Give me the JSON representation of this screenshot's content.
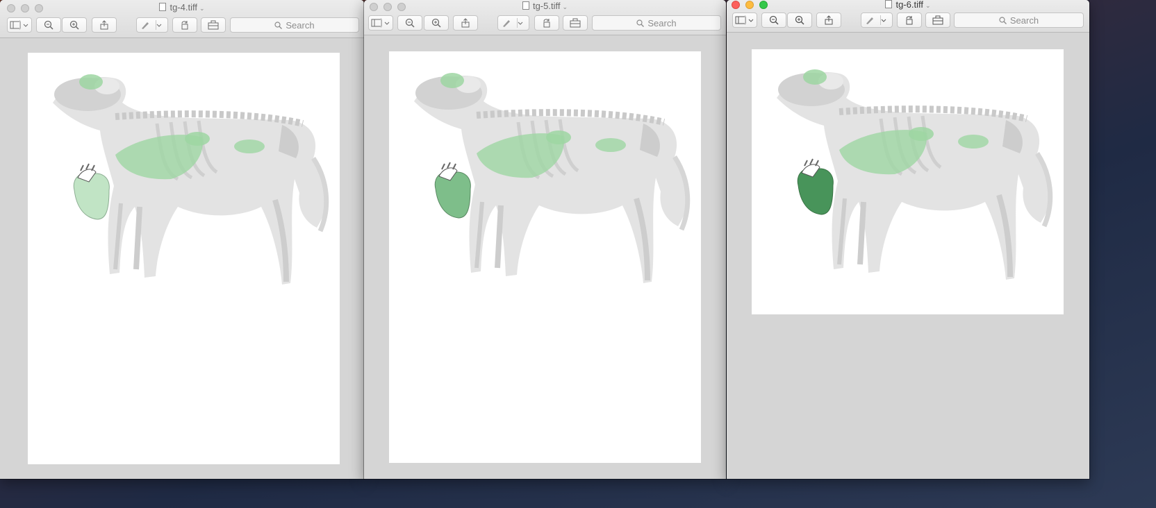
{
  "windows": [
    {
      "title": "tg-4.tiff",
      "active": false,
      "search_placeholder": "Search",
      "heart_opacity": 0.55,
      "heart_fill": "#8fcf96"
    },
    {
      "title": "tg-5.tiff",
      "active": false,
      "search_placeholder": "Search",
      "heart_opacity": 0.8,
      "heart_fill": "#5fae6e"
    },
    {
      "title": "tg-6.tiff",
      "active": true,
      "search_placeholder": "Search",
      "heart_opacity": 0.95,
      "heart_fill": "#3f8f52"
    }
  ],
  "icons": [
    "sidebar-icon",
    "zoom-out-icon",
    "zoom-in-icon",
    "share-icon",
    "markup-pen-icon",
    "rotate-icon",
    "toolbox-icon",
    "search-icon"
  ],
  "colors": {
    "organ_green": "#9ed6a2",
    "skeleton_gray": "#d8d8d8",
    "close": "#fc605c",
    "minimize": "#fdbc40",
    "maximize": "#34c84a"
  }
}
